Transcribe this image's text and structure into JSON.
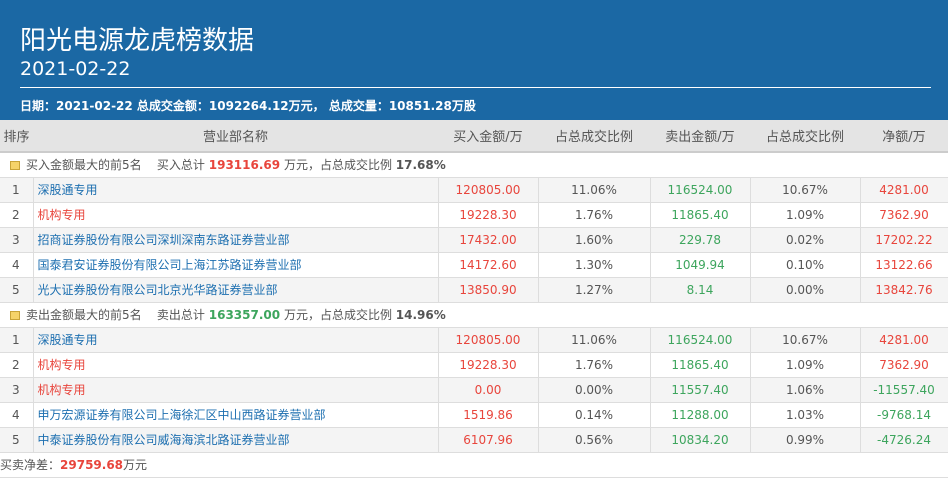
{
  "header": {
    "title": "阳光电源龙虎榜数据",
    "date": "2021-02-22",
    "info": "日期：2021-02-22 总成交金额：1092264.12万元， 总成交量：10851.28万股"
  },
  "columns": [
    "排序",
    "营业部名称",
    "买入金额/万",
    "占总成交比例",
    "卖出金额/万",
    "占总成交比例",
    "净额/万"
  ],
  "buy_group": {
    "label": "买入金额最大的前5名",
    "total_label": "买入总计",
    "total": "193116.69",
    "unit": "万元，占总成交比例",
    "pct": "17.68%"
  },
  "buy_rows": [
    {
      "rank": "1",
      "name": "深股通专用",
      "type": "blue",
      "buy": "120805.00",
      "buy_pct": "11.06%",
      "sell": "116524.00",
      "sell_pct": "10.67%",
      "net": "4281.00"
    },
    {
      "rank": "2",
      "name": "机构专用",
      "type": "red",
      "buy": "19228.30",
      "buy_pct": "1.76%",
      "sell": "11865.40",
      "sell_pct": "1.09%",
      "net": "7362.90"
    },
    {
      "rank": "3",
      "name": "招商证券股份有限公司深圳深南东路证券营业部",
      "type": "blue",
      "buy": "17432.00",
      "buy_pct": "1.60%",
      "sell": "229.78",
      "sell_pct": "0.02%",
      "net": "17202.22"
    },
    {
      "rank": "4",
      "name": "国泰君安证券股份有限公司上海江苏路证券营业部",
      "type": "blue",
      "buy": "14172.60",
      "buy_pct": "1.30%",
      "sell": "1049.94",
      "sell_pct": "0.10%",
      "net": "13122.66"
    },
    {
      "rank": "5",
      "name": "光大证券股份有限公司北京光华路证券营业部",
      "type": "blue",
      "buy": "13850.90",
      "buy_pct": "1.27%",
      "sell": "8.14",
      "sell_pct": "0.00%",
      "net": "13842.76"
    }
  ],
  "sell_group": {
    "label": "卖出金额最大的前5名",
    "total_label": "卖出总计",
    "total": "163357.00",
    "unit": "万元，占总成交比例",
    "pct": "14.96%"
  },
  "sell_rows": [
    {
      "rank": "1",
      "name": "深股通专用",
      "type": "blue",
      "buy": "120805.00",
      "buy_pct": "11.06%",
      "sell": "116524.00",
      "sell_pct": "10.67%",
      "net": "4281.00"
    },
    {
      "rank": "2",
      "name": "机构专用",
      "type": "red",
      "buy": "19228.30",
      "buy_pct": "1.76%",
      "sell": "11865.40",
      "sell_pct": "1.09%",
      "net": "7362.90"
    },
    {
      "rank": "3",
      "name": "机构专用",
      "type": "red",
      "buy": "0.00",
      "buy_pct": "0.00%",
      "sell": "11557.40",
      "sell_pct": "1.06%",
      "net": "-11557.40"
    },
    {
      "rank": "4",
      "name": "申万宏源证券有限公司上海徐汇区中山西路证券营业部",
      "type": "blue",
      "buy": "1519.86",
      "buy_pct": "0.14%",
      "sell": "11288.00",
      "sell_pct": "1.03%",
      "net": "-9768.14"
    },
    {
      "rank": "5",
      "name": "中泰证券股份有限公司威海海滨北路证券营业部",
      "type": "blue",
      "buy": "6107.96",
      "buy_pct": "0.56%",
      "sell": "10834.20",
      "sell_pct": "0.99%",
      "net": "-4726.24"
    }
  ],
  "footer": {
    "label": "买卖净差：",
    "value": "29759.68",
    "unit": "万元"
  }
}
